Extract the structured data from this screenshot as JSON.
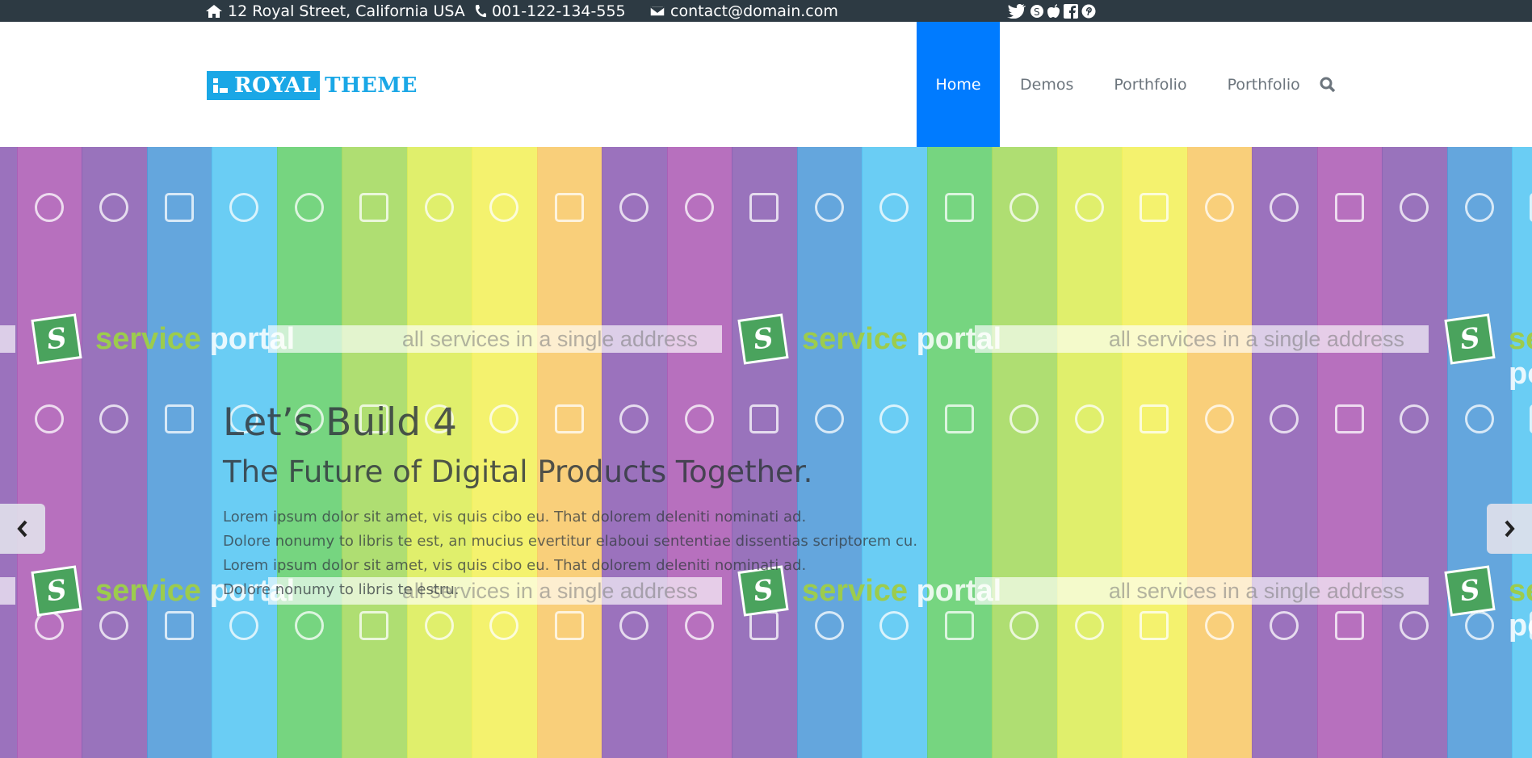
{
  "topbar": {
    "address": "12 Royal Street, California USA",
    "phone": "001-122-134-555",
    "email": "contact@domain.com",
    "icons": [
      "home-icon",
      "phone-icon",
      "envelope-icon"
    ],
    "socials": [
      "twitter-icon",
      "skype-icon",
      "apple-icon",
      "facebook-icon",
      "pinterest-icon"
    ],
    "background": "#2d3a43"
  },
  "logo": {
    "part1": "ROYAL",
    "part2": "THEME",
    "color": "#1aa7e6"
  },
  "nav": {
    "items": [
      {
        "label": "Home",
        "active": true
      },
      {
        "label": "Demos",
        "active": false
      },
      {
        "label": "Porthfolio",
        "active": false
      },
      {
        "label": "Porthfolio",
        "active": false
      }
    ],
    "search_icon": "search-icon",
    "active_color": "#007bff"
  },
  "hero": {
    "title": "Let’s Build 4",
    "subtitle": "The Future of Digital Products Together.",
    "paragraph_lines": [
      "Lorem ipsum dolor sit amet, vis quis cibo eu. That dolorem deleniti nominati ad.",
      "Dolore nonumy to libris te est, an mucius evertitur elaboui sententiae dissentias scriptorem cu.",
      "Lorem ipsum dolor sit amet, vis quis cibo eu. That dolorem deleniti nominati ad.",
      "Dolore nonumy to libris te estru."
    ],
    "banner_brand_1": "service",
    "banner_brand_2": "portal",
    "banner_tagline": "all services in a single address",
    "banner_logo_letter": "S",
    "stripe_colors": [
      "#8d5fb4",
      "#ad5cb5",
      "#8b60b3",
      "#4f9ad8",
      "#55c6f2",
      "#63cf6e",
      "#a4d95e",
      "#dced58",
      "#f2f05a",
      "#f8c868"
    ],
    "prev_icon": "chevron-left-icon",
    "next_icon": "chevron-right-icon"
  }
}
